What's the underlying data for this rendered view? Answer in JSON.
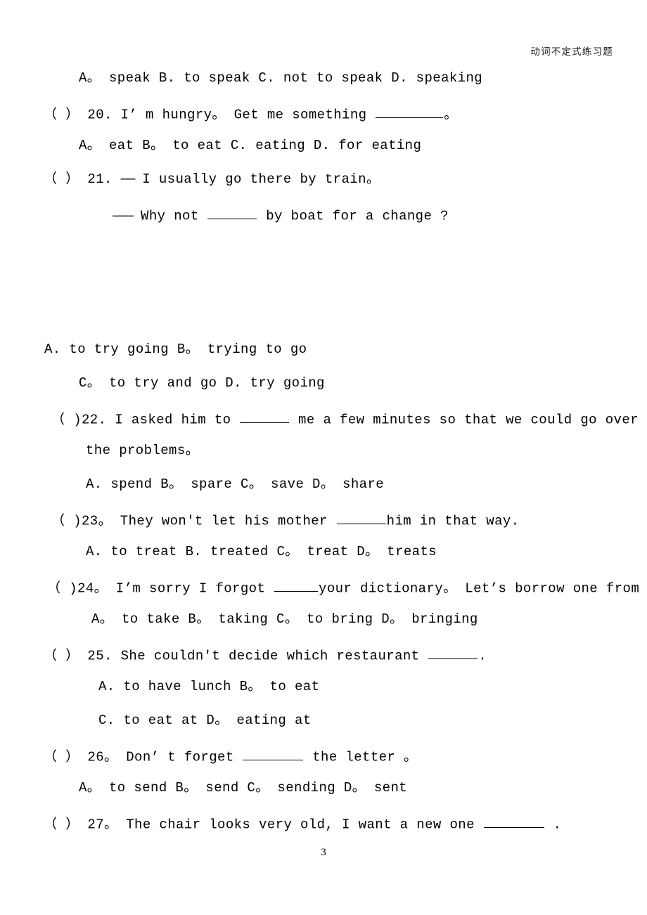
{
  "document": {
    "header_title": "动词不定式练习题",
    "page_number": "3",
    "ink_color": "#000000",
    "paper_color": "#ffffff"
  },
  "lines": {
    "q19_options": "A。 speak   B. to speak   C. not to speak   D. speaking",
    "q20_stem_pre": "（ ） 20. I’ m hungry。 Get me something ",
    "q20_stem_post": "。",
    "q20_options": "A。 eat  B。 to eat  C. eating  D. for eating",
    "q21_marker": "（ ） 21. ",
    "q21_dash1": "——",
    "q21_stem1": " I usually go there by train。",
    "q21_dash2": "———",
    "q21_stem2_pre": " Why not ",
    "q21_stem2_post": " by boat for a change ?",
    "q21_options_ab": "A. to try going      B。 trying to go",
    "q21_options_cd": "C。 to try and go     D. try going",
    "q22_stem_pre": "（ )22. I asked him to ",
    "q22_stem_post": " me a few minutes so that we could go over all",
    "q22_stem_line2": "the problems。",
    "q22_options": "A. spend  B。 spare  C。 save  D。 share",
    "q23_stem_pre": "（ )23。 They won't let his mother ",
    "q23_stem_post": "him in that way.",
    "q23_options": "A. to treat  B. treated  C。 treat   D。 treats",
    "q24_stem_pre": "（ )24。 I’m sorry I forgot ",
    "q24_stem_post": "your dictionary。 Let’s borrow one from Li Ming.",
    "q24_options": "A。 to take  B。 taking  C。 to bring  D。 bringing",
    "q25_stem_pre": "（ ） 25. She couldn't decide which restaurant ",
    "q25_stem_post": ".",
    "q25_options_ab": "A. to have lunch    B。 to eat",
    "q25_options_cd": "C. to eat at     D。 eating at",
    "q26_stem_pre": "（ ） 26。 Don’ t forget ",
    "q26_stem_post": " the letter 。",
    "q26_options": "A。 to send    B。 send    C。 sending    D。 sent",
    "q27_stem_pre": "（ ） 27。 The chair looks very old, I want a new one ",
    "q27_stem_post": " ."
  }
}
